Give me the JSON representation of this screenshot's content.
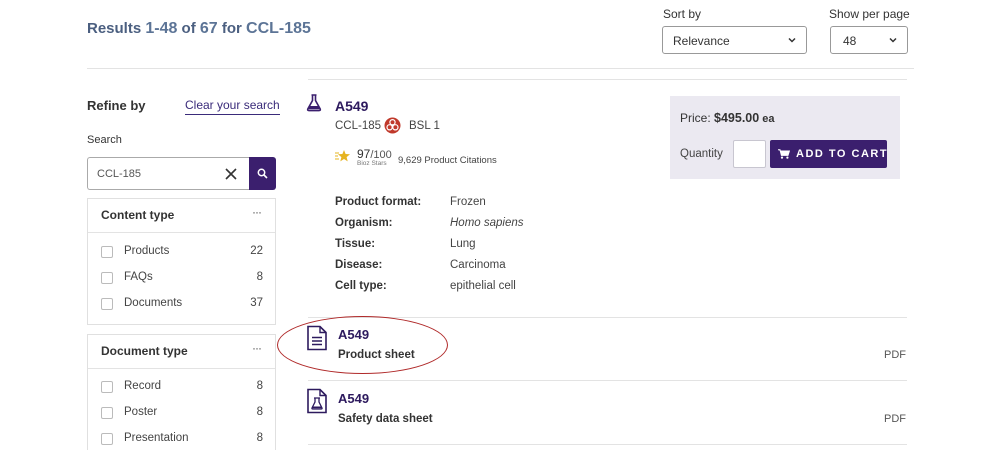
{
  "results": {
    "prefix": "Results ",
    "range": "1-48",
    "of": " of ",
    "total": "67",
    "for": " for ",
    "query": "CCL-185"
  },
  "sort": {
    "label": "Sort by",
    "value": "Relevance",
    "icon": "chevron-down-icon"
  },
  "per_page": {
    "label": "Show per page",
    "value": "48",
    "icon": "chevron-down-icon"
  },
  "sidebar": {
    "refine_label": "Refine by",
    "clear_label": "Clear your search",
    "search_label": "Search",
    "search_value": "CCL-185",
    "facets": [
      {
        "title": "Content type",
        "dots": "···",
        "items": [
          {
            "label": "Products",
            "count": "22"
          },
          {
            "label": "FAQs",
            "count": "8"
          },
          {
            "label": "Documents",
            "count": "37"
          }
        ]
      },
      {
        "title": "Document type",
        "dots": "···",
        "items": [
          {
            "label": "Record",
            "count": "8"
          },
          {
            "label": "Poster",
            "count": "8"
          },
          {
            "label": "Presentation",
            "count": "8"
          }
        ]
      }
    ]
  },
  "product": {
    "name": "A549",
    "code": "CCL-185",
    "bsl": "BSL 1",
    "bioz_score": "97",
    "bioz_max": "/100",
    "bioz_sub": "Bioz Stars",
    "citations": "9,629 Product Citations",
    "attributes": [
      {
        "label": "Product format:",
        "value": "Frozen"
      },
      {
        "label": "Organism:",
        "value": "Homo sapiens"
      },
      {
        "label": "Tissue:",
        "value": "Lung"
      },
      {
        "label": "Disease:",
        "value": "Carcinoma"
      },
      {
        "label": "Cell type:",
        "value": "epithelial cell"
      }
    ],
    "price_label": "Price: ",
    "price": "$495.00",
    "price_unit": " ea",
    "qty_label": "Quantity",
    "add_to_cart": "ADD TO CART"
  },
  "documents": [
    {
      "name": "A549",
      "type": "Product sheet",
      "format": "PDF",
      "icon": "document-icon"
    },
    {
      "name": "A549",
      "type": "Safety data sheet",
      "format": "PDF",
      "icon": "safety-flask-document-icon"
    }
  ],
  "colors": {
    "brand": "#3b1f6e",
    "price_bg": "#ebe9f1",
    "annotation": "#b02a2a"
  }
}
